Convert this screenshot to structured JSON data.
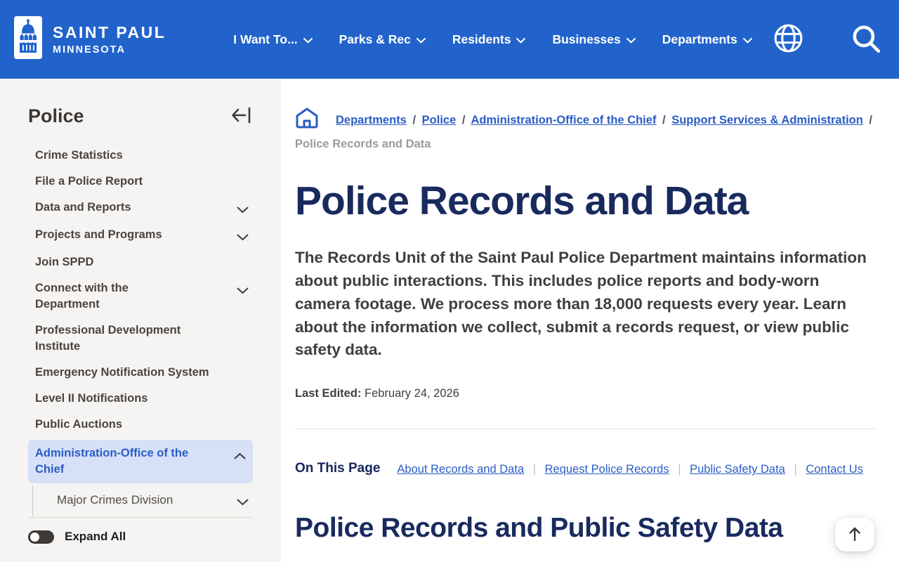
{
  "colors": {
    "header_blue": "#2163cb",
    "link_blue": "#2b5cc5",
    "heading_navy": "#192a5e",
    "sidebar_bg": "#f5f4f2",
    "active_item_bg": "#d6e1f7"
  },
  "header": {
    "logo_line1": "SAINT PAUL",
    "logo_line2": "MINNESOTA",
    "nav": [
      {
        "label": "I Want To..."
      },
      {
        "label": "Parks & Rec"
      },
      {
        "label": "Residents"
      },
      {
        "label": "Businesses"
      },
      {
        "label": "Departments"
      }
    ]
  },
  "sidebar": {
    "title": "Police",
    "items": [
      {
        "label": "Crime Statistics"
      },
      {
        "label": "File a Police Report"
      },
      {
        "label": "Data and Reports"
      },
      {
        "label": "Projects and Programs"
      },
      {
        "label": "Join SPPD"
      },
      {
        "label": "Connect with the\nDepartment"
      },
      {
        "label": "Professional Development\nInstitute"
      },
      {
        "label": "Emergency Notification System"
      },
      {
        "label": "Level II Notifications"
      },
      {
        "label": "Public Auctions"
      },
      {
        "label": "Administration-Office of the\nChief"
      },
      {
        "label": "Major Crimes Division"
      }
    ],
    "expand_all_label": "Expand All"
  },
  "breadcrumb": {
    "separator": "/",
    "links": [
      "Departments",
      "Police",
      "Administration-Office of the Chief",
      "Support Services & Administration"
    ],
    "current": "Police Records and Data"
  },
  "main": {
    "title": "Police Records and Data",
    "intro": "The Records Unit of the Saint Paul Police Department maintains information about public interactions. This includes police reports and body-worn camera footage. We process more than 18,000 requests every year. Learn about the information we collect, submit a records request, or view public safety data.",
    "last_edited_label": "Last Edited:",
    "last_edited_date": "February 24, 2026",
    "on_this_page": {
      "label": "On This Page",
      "divider": "|",
      "links": [
        "About Records and Data",
        "Request Police Records",
        "Public Safety Data",
        "Contact Us"
      ]
    },
    "section_title": "Police Records and Public Safety Data"
  }
}
